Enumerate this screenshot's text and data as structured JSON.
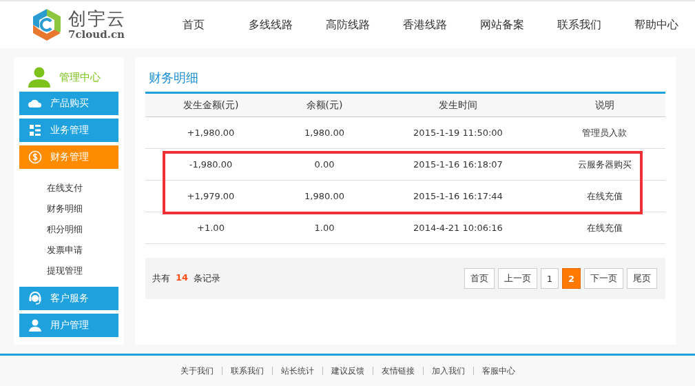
{
  "logo": {
    "name": "创宇云",
    "domain": "7cloud.cn"
  },
  "nav": [
    "首页",
    "多线线路",
    "高防线路",
    "香港线路",
    "网站备案",
    "联系我们",
    "帮助中心"
  ],
  "sidebar": {
    "title": "管理中心",
    "items": [
      {
        "label": "产品购买",
        "kind": "cloud",
        "selected": false
      },
      {
        "label": "业务管理",
        "kind": "list",
        "selected": false
      },
      {
        "label": "财务管理",
        "kind": "dollar",
        "selected": true,
        "children": [
          "在线支付",
          "财务明细",
          "积分明细",
          "发票申请",
          "提现管理"
        ]
      },
      {
        "label": "客户服务",
        "kind": "headset",
        "selected": false
      },
      {
        "label": "用户管理",
        "kind": "user",
        "selected": false
      }
    ]
  },
  "page_title": "财务明细",
  "table": {
    "columns": [
      "发生金额(元)",
      "余额(元)",
      "发生时间",
      "说明"
    ],
    "rows": [
      {
        "cells": [
          "+1,980.00",
          "1,980.00",
          "2015-1-19 11:50:00",
          "管理员入款"
        ],
        "highlighted": false
      },
      {
        "cells": [
          "-1,980.00",
          "0.00",
          "2015-1-16 16:18:07",
          "云服务器购买"
        ],
        "highlighted": true
      },
      {
        "cells": [
          "+1,979.00",
          "1,980.00",
          "2015-1-16 16:17:44",
          "在线充值"
        ],
        "highlighted": true
      },
      {
        "cells": [
          "+1.00",
          "1.00",
          "2014-4-21 10:06:16",
          "在线充值"
        ],
        "highlighted": false
      }
    ]
  },
  "record_count": {
    "prefix": "共有",
    "value": "14",
    "suffix": "条记录"
  },
  "pagination": [
    {
      "label": "首页",
      "selected": false
    },
    {
      "label": "上一页",
      "selected": false
    },
    {
      "label": "1",
      "selected": false
    },
    {
      "label": "2",
      "selected": true
    },
    {
      "label": "下一页",
      "selected": false
    },
    {
      "label": "尾页",
      "selected": false
    }
  ],
  "footer_links": [
    "关于我们",
    "联系我们",
    "站长统计",
    "建议反馈",
    "友情链接",
    "加入我们",
    "客服中心"
  ]
}
